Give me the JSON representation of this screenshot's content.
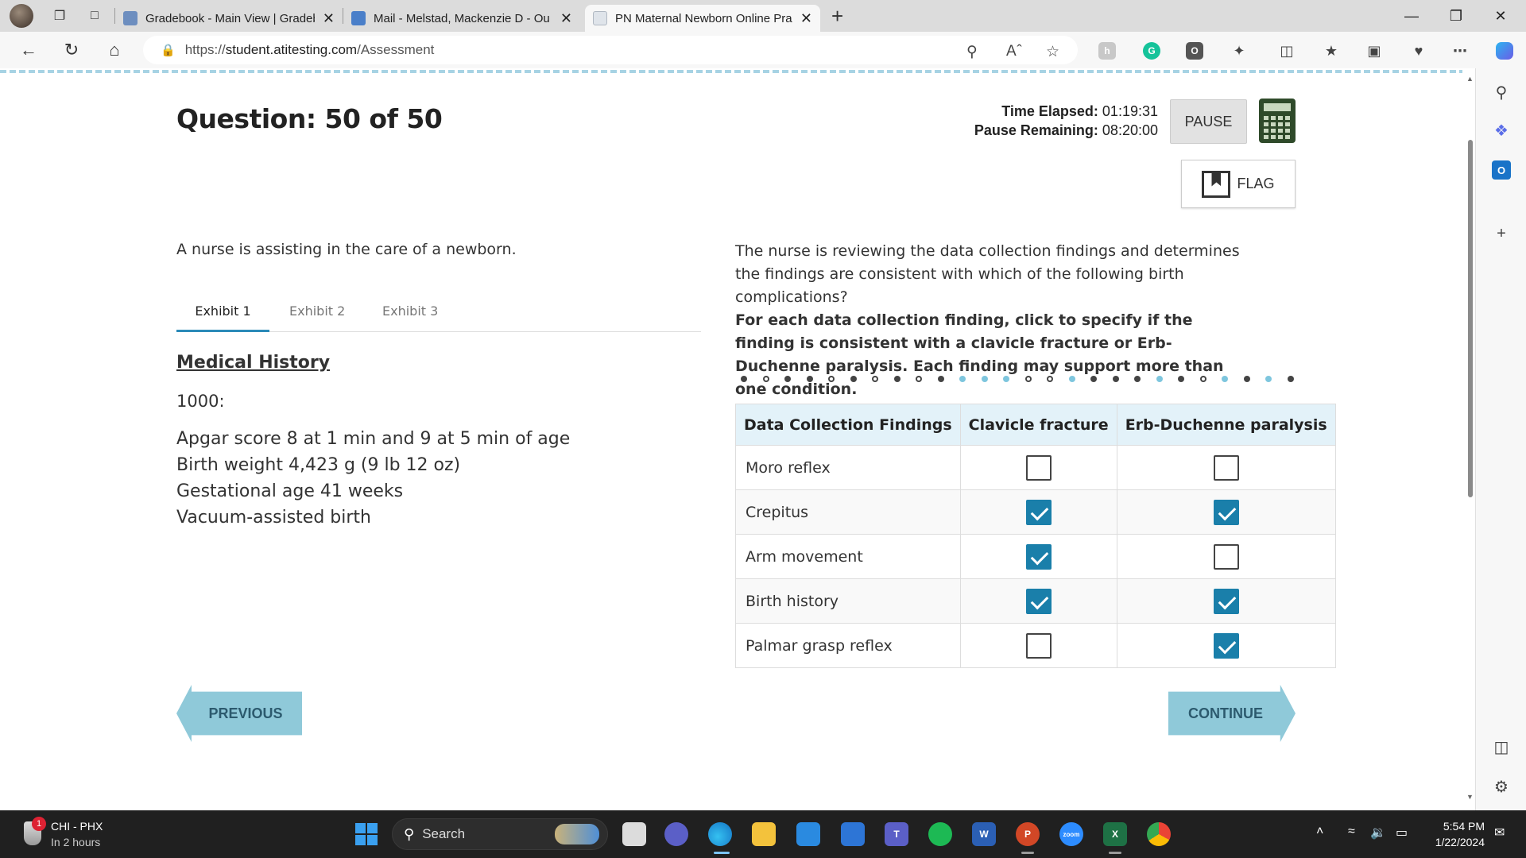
{
  "browser": {
    "tabs": [
      {
        "label": "Gradebook - Main View | Gradeb",
        "active": false
      },
      {
        "label": "Mail - Melstad, Mackenzie D - Ou",
        "active": false
      },
      {
        "label": "PN Maternal Newborn Online Pra",
        "active": true
      }
    ],
    "url_scheme": "https://",
    "url_host": "student.atitesting.com",
    "url_path": "/Assessment"
  },
  "question": {
    "title": "Question: 50 of 50",
    "time_elapsed_label": "Time Elapsed:",
    "time_elapsed": "01:19:31",
    "pause_remaining_label": "Pause Remaining:",
    "pause_remaining": "08:20:00",
    "pause_label": "PAUSE",
    "flag_label": "FLAG"
  },
  "left": {
    "stem": "A nurse is assisting in the care of a newborn.",
    "exhibit_tabs": [
      "Exhibit 1",
      "Exhibit 2",
      "Exhibit 3"
    ],
    "heading": "Medical History",
    "time": "1000:",
    "history": [
      "Apgar score 8 at 1 min and 9 at 5 min of age",
      "Birth weight 4,423 g (9 lb 12 oz)",
      "Gestational age 41 weeks",
      "Vacuum-assisted birth"
    ]
  },
  "right": {
    "stem": "The nurse is reviewing the data collection findings and determines the findings are consistent with which of the following birth complications?",
    "instruction": "For each data collection finding, click to specify if the finding is consistent with a clavicle fracture or Erb-Duchenne paralysis. Each finding may support more than one condition.",
    "progress_dots": [
      "f",
      "h",
      "f",
      "f",
      "h",
      "f",
      "h",
      "f",
      "h",
      "f",
      "b",
      "b",
      "b",
      "h",
      "h",
      "b",
      "f",
      "f",
      "f",
      "b",
      "f",
      "h",
      "b",
      "f",
      "b",
      "f"
    ],
    "table": {
      "headers": [
        "Data Collection Findings",
        "Clavicle fracture",
        "Erb-Duchenne paralysis"
      ],
      "rows": [
        {
          "finding": "Moro reflex",
          "clavicle": false,
          "erb": false
        },
        {
          "finding": "Crepitus",
          "clavicle": true,
          "erb": true
        },
        {
          "finding": "Arm movement",
          "clavicle": true,
          "erb": false
        },
        {
          "finding": "Birth history",
          "clavicle": true,
          "erb": true
        },
        {
          "finding": "Palmar grasp reflex",
          "clavicle": false,
          "erb": true
        }
      ]
    }
  },
  "nav": {
    "previous": "PREVIOUS",
    "continue": "CONTINUE"
  },
  "taskbar": {
    "weather_badge": "1",
    "weather_title": "CHI - PHX",
    "weather_sub": "In 2 hours",
    "search": "Search",
    "time": "5:54 PM",
    "date": "1/22/2024"
  }
}
